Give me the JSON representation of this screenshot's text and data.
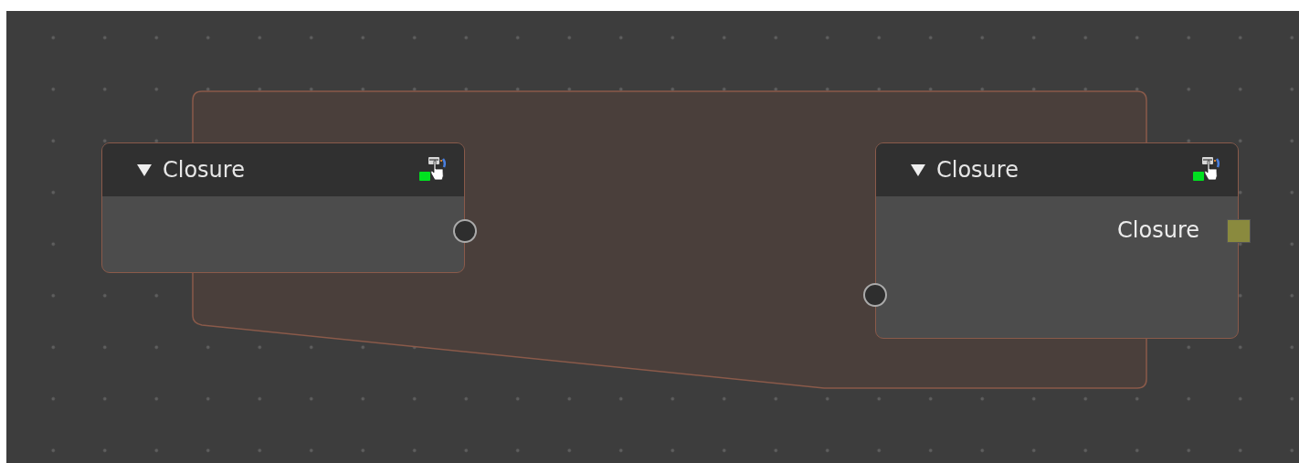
{
  "zone": {
    "color": "#4a3f3b"
  },
  "nodes": [
    {
      "title": "Closure",
      "expanded": true,
      "outputs": [
        {
          "kind": "circle",
          "color": "#2e2e2e"
        }
      ]
    },
    {
      "title": "Closure",
      "expanded": true,
      "outputs": [
        {
          "label": "Closure",
          "kind": "square",
          "color": "#8a8a3e"
        }
      ],
      "inputs": [
        {
          "kind": "circle",
          "color": "#2e2e2e"
        }
      ]
    }
  ]
}
